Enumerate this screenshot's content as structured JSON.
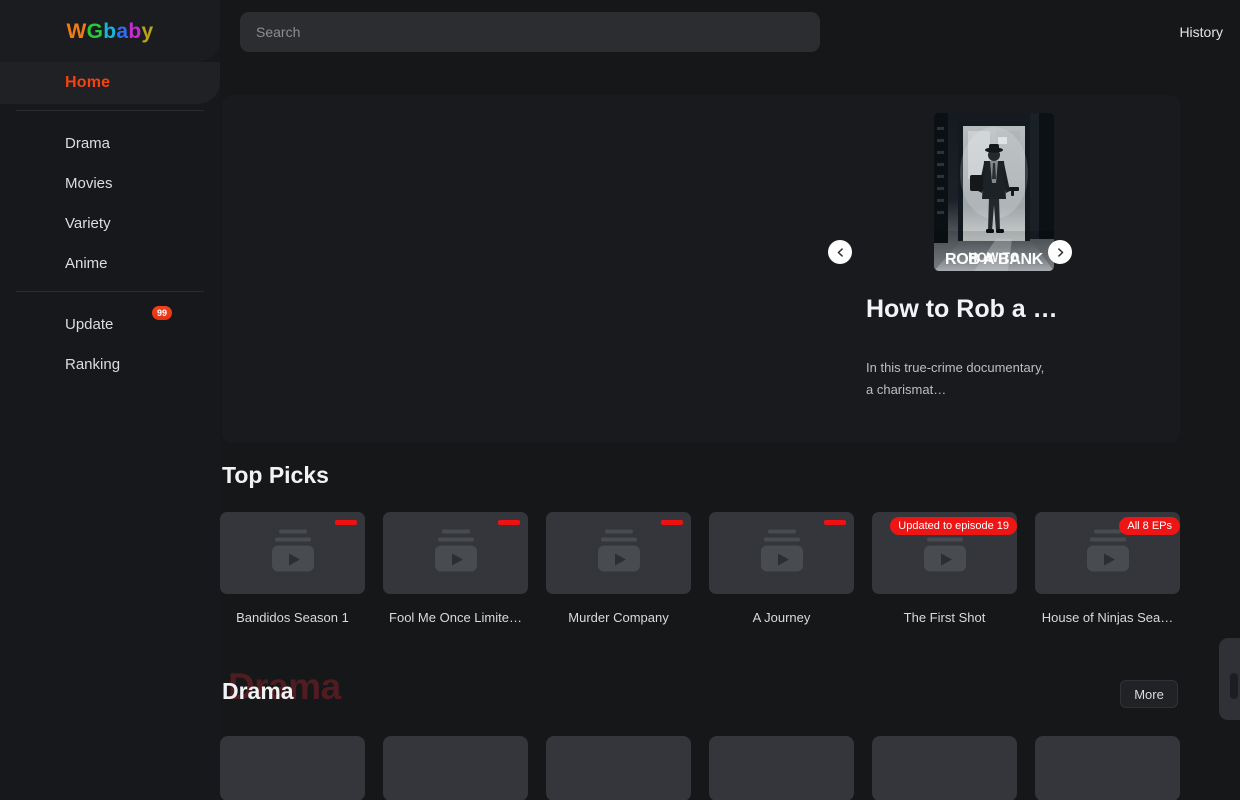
{
  "brand": {
    "name": "WGbaby",
    "letters": [
      {
        "ch": "W",
        "color": "#ef7c12"
      },
      {
        "ch": "G",
        "color": "#27c93f"
      },
      {
        "ch": "b",
        "color": "#19b4d8"
      },
      {
        "ch": "a",
        "color": "#2f6ef0"
      },
      {
        "ch": "b",
        "color": "#c72ad4"
      },
      {
        "ch": "y",
        "color": "#b9a316"
      }
    ]
  },
  "sidebar": {
    "active_label": "Home",
    "items": [
      {
        "label": "Drama",
        "badge": null
      },
      {
        "label": "Movies",
        "badge": null
      },
      {
        "label": "Variety",
        "badge": null
      },
      {
        "label": "Anime",
        "badge": null
      },
      {
        "label": "Update",
        "badge": "99"
      },
      {
        "label": "Ranking",
        "badge": null
      }
    ]
  },
  "topbar": {
    "search_placeholder": "Search",
    "search_value": "",
    "history_label": "History"
  },
  "hero": {
    "title": "How to Rob a …",
    "description": "In this true-crime documentary, a charismat…",
    "poster_title_line1": "HOW TO",
    "poster_title_line2": "ROB A BANK",
    "prev_label": "‹",
    "next_label": "›"
  },
  "top_picks": {
    "title": "Top Picks",
    "cards": [
      {
        "label": "Bandidos Season 1",
        "tag_type": "bar",
        "tag_text": ""
      },
      {
        "label": "Fool Me Once Limite…",
        "tag_type": "bar",
        "tag_text": ""
      },
      {
        "label": "Murder Company",
        "tag_type": "bar",
        "tag_text": ""
      },
      {
        "label": "A Journey",
        "tag_type": "bar",
        "tag_text": ""
      },
      {
        "label": "The First Shot",
        "tag_type": "pill",
        "tag_text": "Updated to episode 19"
      },
      {
        "label": "House of Ninjas Sea…",
        "tag_type": "pill",
        "tag_text": "All 8 EPs"
      }
    ]
  },
  "drama": {
    "title": "Drama",
    "ghost_title": "Drama",
    "more_label": "More",
    "cards": [
      {
        "label": ""
      },
      {
        "label": ""
      },
      {
        "label": ""
      },
      {
        "label": ""
      },
      {
        "label": ""
      },
      {
        "label": ""
      }
    ]
  },
  "colors": {
    "accent": "#f4430e",
    "badge": "#ee1515",
    "page_bg": "#161719",
    "panel_bg": "#191a1e",
    "card_bg": "#34363b"
  }
}
